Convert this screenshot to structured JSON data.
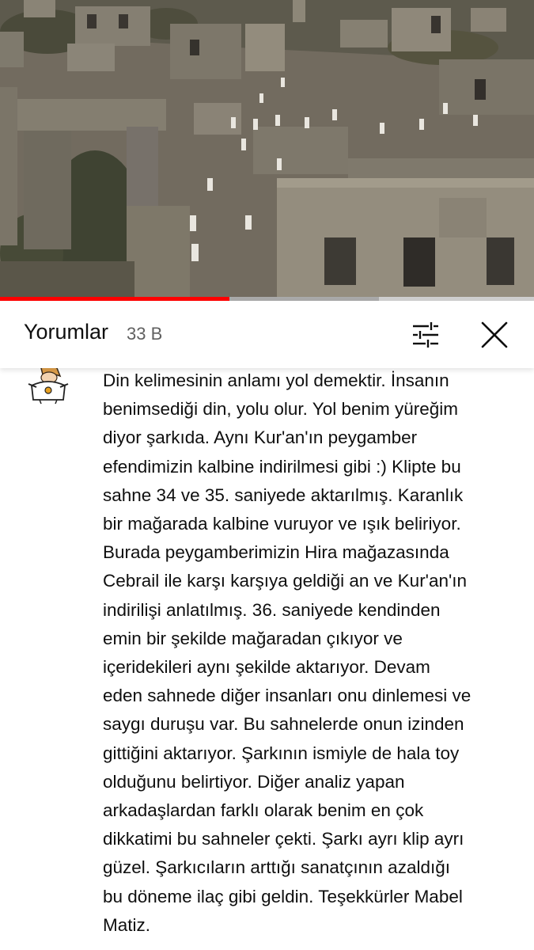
{
  "video": {
    "progress_percent": 43,
    "buffered_percent": 71,
    "colors": {
      "progress": "#ff0000",
      "buffer": "#a9a9a9",
      "track": "#cfcfcf"
    }
  },
  "comments_header": {
    "title": "Yorumlar",
    "count": "33 B",
    "filter_icon": "sliders-icon",
    "close_icon": "close-icon"
  },
  "comment": {
    "avatar_icon": "cartoon-avatar",
    "text": "Din kelimesinin anlamı yol demektir. İnsanın\nbenimsediği din, yolu olur. Yol benim yüreğim\ndiyor şarkıda. Aynı Kur'an'ın peygamber\nefendimizin kalbine indirilmesi gibi :) Klipte bu\nsahne 34 ve 35. saniyede aktarılmış. Karanlık\nbir mağarada kalbine vuruyor ve ışık beliriyor.\nBurada peygamberimizin Hira mağazasında\nCebrail ile karşı karşıya geldiği an ve Kur'an'ın\nindirilişi anlatılmış. 36. saniyede kendinden\nemin bir şekilde mağaradan çıkıyor ve\niçeridekileri aynı şekilde aktarıyor. Devam\neden sahnede diğer insanları onu dinlemesi ve\nsaygı duruşu var. Bu sahnelerde onun izinden\ngittiğini aktarıyor. Şarkının ismiyle de hala toy\nolduğunu belirtiyor. Diğer analiz yapan\narkadaşlardan farklı olarak benim en çok\ndikkatimi bu sahneler çekti. Şarkı ayrı klip ayrı\ngüzel. Şarkıcıların arttığı sanatçının azaldığı\nbu döneme ilaç gibi geldin. Teşekkürler Mabel\nMatiz."
  }
}
